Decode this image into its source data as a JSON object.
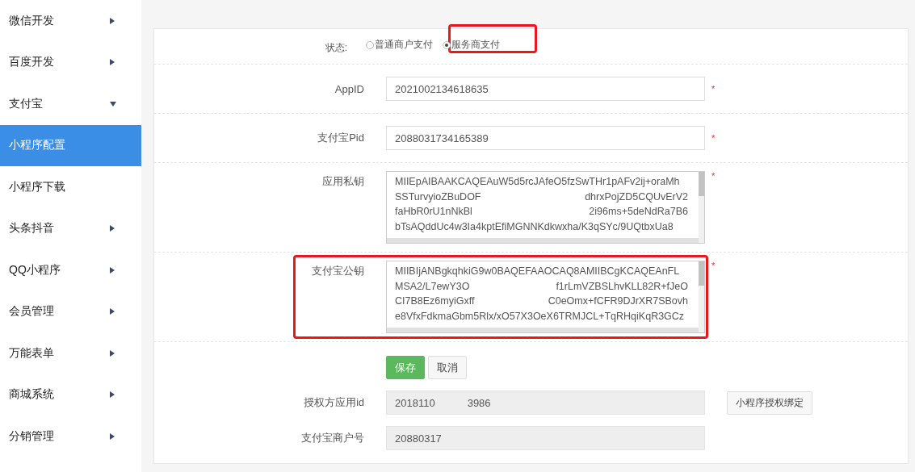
{
  "sidebar": {
    "items": [
      {
        "label": "微信开发",
        "expanded": false
      },
      {
        "label": "百度开发",
        "expanded": false
      },
      {
        "label": "支付宝",
        "expanded": true,
        "children": [
          {
            "label": "小程序配置",
            "selected": true
          },
          {
            "label": "小程序下载",
            "selected": false
          }
        ]
      },
      {
        "label": "头条抖音",
        "expanded": false
      },
      {
        "label": "QQ小程序",
        "expanded": false
      },
      {
        "label": "会员管理",
        "expanded": false
      },
      {
        "label": "万能表单",
        "expanded": false
      },
      {
        "label": "商城系统",
        "expanded": false
      },
      {
        "label": "分销管理",
        "expanded": false
      }
    ]
  },
  "form": {
    "status": {
      "label": "状态:",
      "highlighted": true,
      "options": [
        {
          "label": "普通商户支付",
          "selected": false
        },
        {
          "label": "服务商支付",
          "selected": true
        }
      ]
    },
    "fields": [
      {
        "kind": "input",
        "label": "AppID",
        "value": "2021002134618635",
        "required_mark": "*",
        "highlighted": false
      },
      {
        "kind": "input",
        "label": "支付宝Pid",
        "value": "2088031734165389",
        "required_mark": "*",
        "highlighted": false
      },
      {
        "kind": "textarea",
        "label": "应用私钥",
        "required_mark": "*",
        "highlighted": false,
        "lines": [
          [
            "MIIEpAIBAAKCAQEAuW5d5rcJAfeO5fzSwTHr1pAFv2ij+oraMh"
          ],
          [
            "SSTurvyioZBuDOF",
            "dhrxPojZD5CQUvErV2"
          ],
          [
            "faHbR0rU1nNkBl",
            "2i96ms+5deNdRa7B6"
          ],
          [
            "bTsAQddUc4w3Ia4kptEfiMGNNKdkwxha/K3qSYc/9UQtbxUa8"
          ]
        ]
      },
      {
        "kind": "textarea",
        "label": "支付宝公钥",
        "required_mark": "*",
        "highlighted": true,
        "lines": [
          [
            "MIIBIjANBgkqhkiG9w0BAQEFAAOCAQ8AMIIBCgKCAQEAnFL"
          ],
          [
            "MSA2/L7ewY3O",
            "f1rLmVZBSLhvKLL82R+fJeO"
          ],
          [
            "CI7B8Ez6myiGxff",
            "C0eOmx+fCFR9DJrXR7SBovh"
          ],
          [
            "e8VfxFdkmaGbm5Rlx/xO57X3OeX6TRMJCL+TqRHqiKqR3GCz"
          ]
        ]
      }
    ],
    "buttons": [
      {
        "kind": "primary",
        "label": "保存"
      },
      {
        "kind": "default",
        "label": "取消"
      }
    ],
    "readonly_fields": [
      {
        "label": "授权方应用id",
        "value_parts": [
          "2018110",
          "3986"
        ],
        "button": "小程序授权绑定"
      },
      {
        "label": "支付宝商户号",
        "value_parts": [
          "20880317"
        ]
      }
    ]
  }
}
